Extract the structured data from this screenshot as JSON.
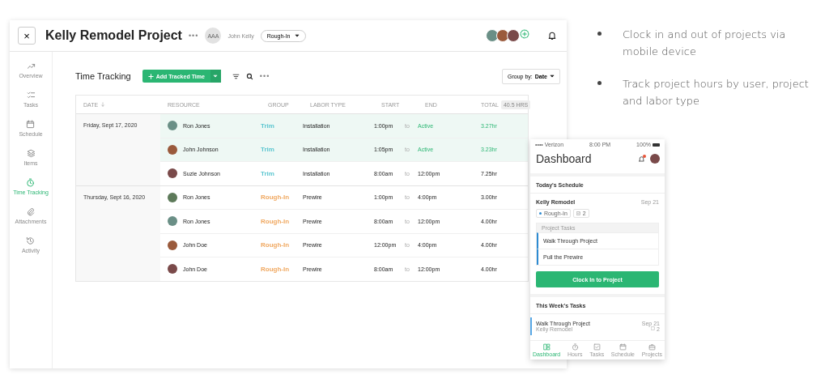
{
  "app": {
    "close": "×",
    "title": "Kelly Remodel Project",
    "more": "•••",
    "owner_initials": "AAA",
    "owner_name": "John Kelly",
    "stage": "Rough-In",
    "nav": [
      {
        "label": "Overview",
        "selected": false
      },
      {
        "label": "Tasks",
        "selected": false
      },
      {
        "label": "Schedule",
        "selected": false
      },
      {
        "label": "Items",
        "selected": false
      },
      {
        "label": "Time Tracking",
        "selected": true
      },
      {
        "label": "Attachments",
        "selected": false
      },
      {
        "label": "Activity",
        "selected": false
      }
    ],
    "section_title": "Time Tracking",
    "add_button": "Add Tracked Time",
    "toolbar_more": "•••",
    "group_by_label": "Group by:",
    "group_by_value": "Date",
    "table": {
      "columns": [
        "DATE",
        "RESOURCE",
        "GROUP",
        "LABOR TYPE",
        "START",
        "END",
        "TOTAL"
      ],
      "total_badge": "40.5 HRS",
      "groups": [
        {
          "date": "Friday, Sept 17, 2020",
          "rows": [
            {
              "resource": "Ron Jones",
              "group": "Trim",
              "color": "#5cc6d0",
              "labor": "Installation",
              "start": "1:00pm",
              "to": "to",
              "end": "Active",
              "total": "3.27hr",
              "active": true
            },
            {
              "resource": "John Johnson",
              "group": "Trim",
              "color": "#5cc6d0",
              "labor": "Installation",
              "start": "1:05pm",
              "to": "to",
              "end": "Active",
              "total": "3.23hr",
              "active": true
            },
            {
              "resource": "Suzie Johnson",
              "group": "Trim",
              "color": "#5cc6d0",
              "labor": "Installation",
              "start": "8:00am",
              "to": "to",
              "end": "12:00pm",
              "total": "7.25hr",
              "active": false
            }
          ]
        },
        {
          "date": "Thursday, Sept 16, 2020",
          "rows": [
            {
              "resource": "Ron Jones",
              "group": "Rough-In",
              "color": "#f0a860",
              "labor": "Prewire",
              "start": "1:00pm",
              "to": "to",
              "end": "4:00pm",
              "total": "3.00hr",
              "active": false
            },
            {
              "resource": "Ron Jones",
              "group": "Rough-In",
              "color": "#f0a860",
              "labor": "Prewire",
              "start": "8:00am",
              "to": "to",
              "end": "12:00pm",
              "total": "4.00hr",
              "active": false
            },
            {
              "resource": "John Doe",
              "group": "Rough-In",
              "color": "#f0a860",
              "labor": "Prewire",
              "start": "12:00pm",
              "to": "to",
              "end": "4:00pm",
              "total": "4.00hr",
              "active": false
            },
            {
              "resource": "John Doe",
              "group": "Rough-In",
              "color": "#f0a860",
              "labor": "Prewire",
              "start": "8:00am",
              "to": "to",
              "end": "12:00pm",
              "total": "4.00hr",
              "active": false
            }
          ]
        }
      ]
    }
  },
  "phone": {
    "carrier": "•••• Verizon",
    "time": "8:00 PM",
    "battery": "100%",
    "title": "Dashboard",
    "schedule_heading": "Today's Schedule",
    "project": "Kelly Remodel",
    "project_date": "Sep 21",
    "tag": "Rough-In",
    "task_count": "2",
    "tasks_panel": "Project Tasks",
    "tasks": [
      "Walk Through Project",
      "Pull the Prewire"
    ],
    "clock_in": "Clock In to Project",
    "week_heading": "This Week's Tasks",
    "week_task": {
      "title": "Walk Through Project",
      "project": "Kelly Remodel",
      "date": "Sep 21",
      "count": "2"
    },
    "tabs": [
      {
        "label": "Dashboard",
        "selected": true
      },
      {
        "label": "Hours",
        "selected": false
      },
      {
        "label": "Tasks",
        "selected": false
      },
      {
        "label": "Schedule",
        "selected": false
      },
      {
        "label": "Projects",
        "selected": false
      }
    ]
  },
  "features": [
    "Clock in and out of projects via mobile device",
    "Track project hours by user, project and labor type"
  ]
}
